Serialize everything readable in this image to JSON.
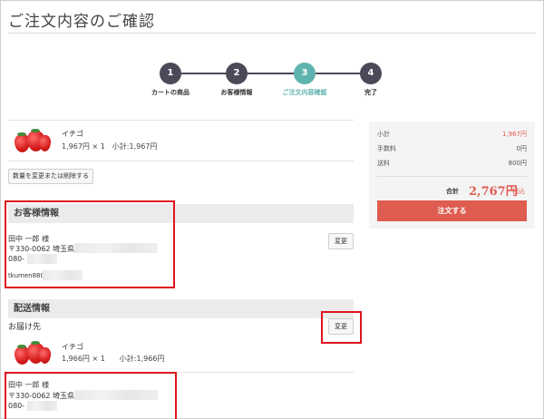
{
  "page": {
    "title": "ご注文内容のご確認"
  },
  "steps": [
    {
      "number": "1",
      "label": "カートの商品"
    },
    {
      "number": "2",
      "label": "お客様情報"
    },
    {
      "number": "3",
      "label": "ご注文内容確認"
    },
    {
      "number": "4",
      "label": "完了"
    }
  ],
  "cart_item": {
    "name": "イチゴ",
    "detail": "1,967円 × 1　小計:1,967円",
    "edit_button": "数量を変更または削除する"
  },
  "customer_section": {
    "heading": "お客様情報",
    "name": "田中 一郎 様",
    "address_prefix": "〒330-0062 埼玉県",
    "phone_prefix": "080-",
    "email_prefix": "tkumen880",
    "change_button": "変更"
  },
  "shipping_section": {
    "heading": "配送情報",
    "destination_label": "お届け先",
    "change_button": "変更",
    "item_name": "イチゴ",
    "item_detail": "1,966円 × 1　　小計:1,966円",
    "name": "田中 一郎 様",
    "address_prefix": "〒330-0062 埼玉県",
    "phone_prefix": "080-"
  },
  "summary": {
    "subtotal_label": "小計",
    "subtotal_value": "1,967円",
    "fee_label": "手数料",
    "fee_value": "0円",
    "shipping_label": "送料",
    "shipping_value": "800円",
    "total_label": "合計",
    "total_value": "2,767円",
    "tax_label": "税込",
    "order_button": "注文する"
  },
  "colors": {
    "accent": "#5fb3ae",
    "step_dark": "#4a4a58",
    "order_button": "#de5d50",
    "highlight_box": "#e0141e"
  }
}
